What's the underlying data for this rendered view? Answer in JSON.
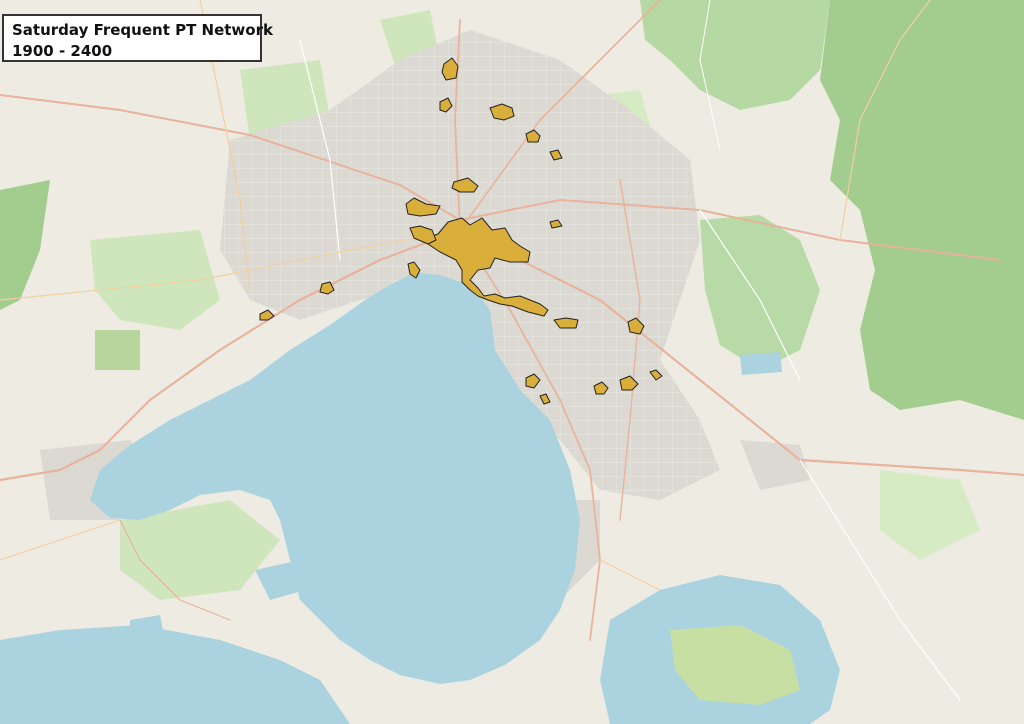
{
  "map": {
    "title": "Saturday Frequent PT Network",
    "subtitle": "1900 - 2400"
  },
  "colors": {
    "water": "#aad3df",
    "land": "#eeebe3",
    "park": "#c8e3b4",
    "forest": "#a3cc8f",
    "urban": "#d9d6d0",
    "road_major": "#e8b39c",
    "road_minor": "#ffffff",
    "coverage_fill": "#d9ae3a",
    "coverage_stroke": "#222222",
    "title_border": "#333333"
  }
}
